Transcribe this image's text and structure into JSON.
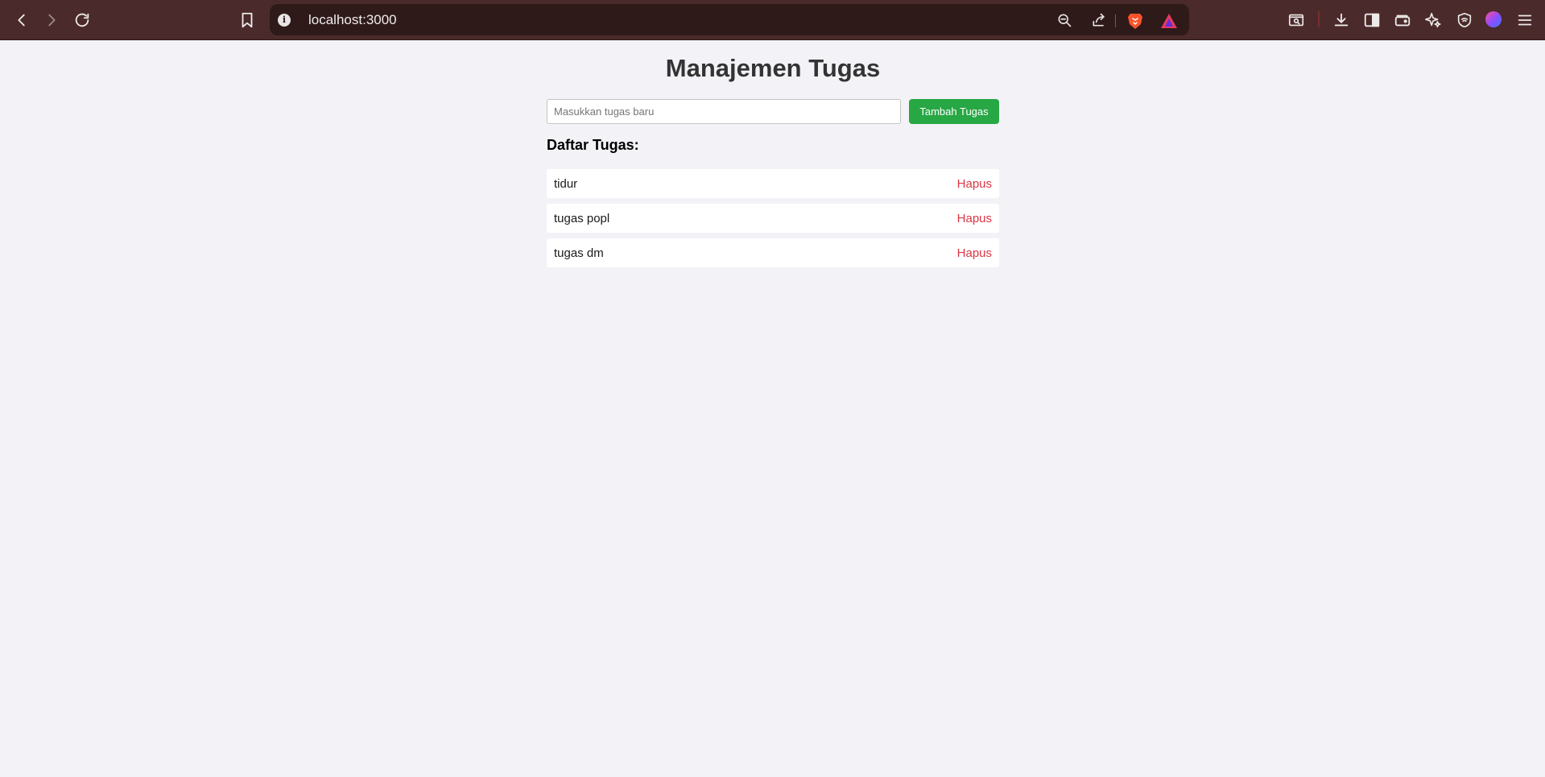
{
  "browser": {
    "url": "localhost:3000"
  },
  "app": {
    "title": "Manajemen Tugas",
    "input_placeholder": "Masukkan tugas baru",
    "input_value": "",
    "add_button_label": "Tambah Tugas",
    "list_heading": "Daftar Tugas:",
    "tasks": [
      {
        "text": "tidur",
        "delete_label": "Hapus"
      },
      {
        "text": "tugas popl",
        "delete_label": "Hapus"
      },
      {
        "text": "tugas dm",
        "delete_label": "Hapus"
      }
    ]
  },
  "colors": {
    "chrome_bg": "#4a2a2a",
    "page_bg": "#f3f2f7",
    "add_button": "#28a745",
    "delete_link": "#dc3545"
  }
}
